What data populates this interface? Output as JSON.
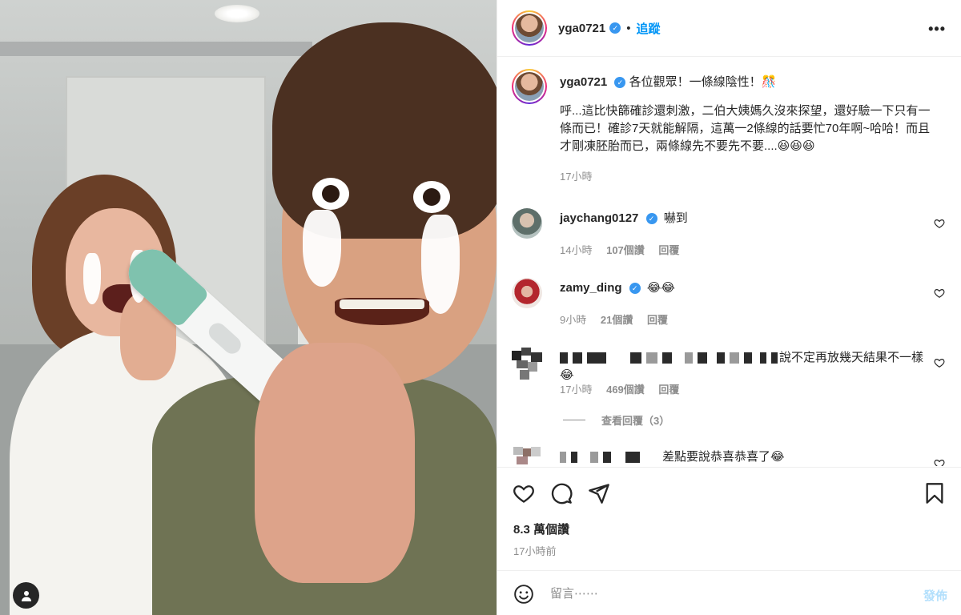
{
  "post": {
    "author": "yga0721",
    "follow_label": "追蹤",
    "separator": "•",
    "more_label": "•••"
  },
  "caption": {
    "username": "yga0721",
    "headline": "各位觀眾！一條線陰性！🎊",
    "text": "呼...這比快篩確診還刺激，二伯大姨媽久沒來探望，還好驗一下只有一條而已！確診7天就能解隔，這萬一2條線的話要忙70年啊~哈哈！而且才剛凍胚胎而已，兩條線先不要先不要....😆😆😆",
    "time": "17小時"
  },
  "comments": [
    {
      "username": "jaychang0127",
      "text": "嚇到",
      "time": "14小時",
      "likes": "107個讚",
      "reply": "回覆"
    },
    {
      "username": "zamy_ding",
      "text": "😂😂",
      "time": "9小時",
      "likes": "21個讚",
      "reply": "回覆"
    },
    {
      "username": "",
      "text": "說不定再放幾天結果不一樣😂",
      "time": "17小時",
      "likes": "469個讚",
      "reply": "回覆"
    },
    {
      "username": "",
      "text": "差點要說恭喜恭喜了😂",
      "time": "",
      "likes": "",
      "reply": ""
    }
  ],
  "view_replies": "查看回覆（3）",
  "stats": {
    "likes": "8.3 萬個讚",
    "posted": "17小時前"
  },
  "composer": {
    "placeholder": "留言⋯⋯",
    "post_label": "發佈"
  },
  "icons": [
    "heart-icon",
    "comment-icon",
    "share-icon",
    "bookmark-icon",
    "emoji-icon",
    "user-tag-icon",
    "verified-badge-icon",
    "more-options-icon"
  ],
  "colors": {
    "accent": "#0095f6",
    "verified": "#3897f0",
    "muted": "#8e8e8e",
    "post_disabled": "#b2dffc"
  }
}
